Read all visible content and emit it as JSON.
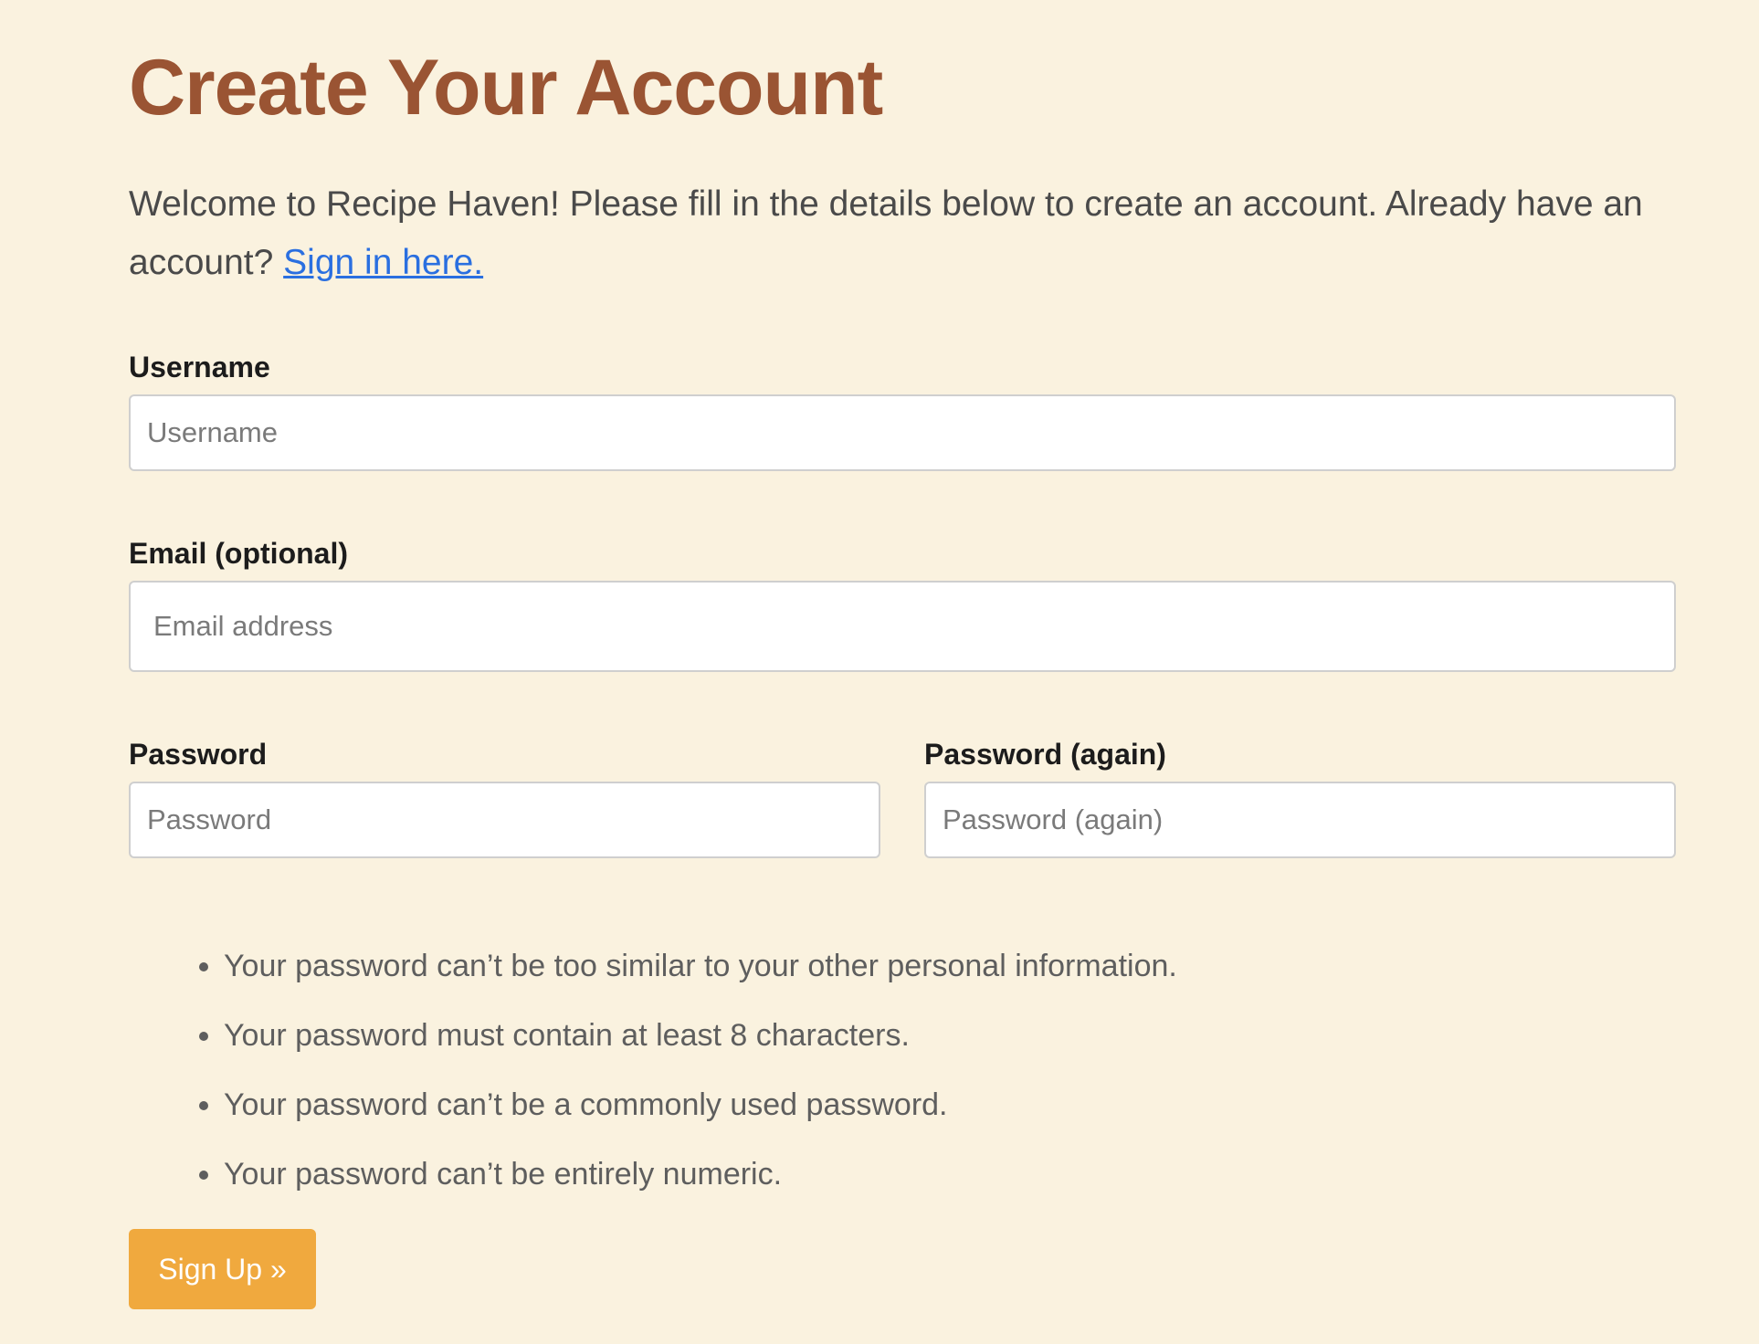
{
  "page": {
    "title": "Create Your Account",
    "intro_text": "Welcome to Recipe Haven! Please fill in the details below to create an account. Already have an account?",
    "signin_link": "Sign in here."
  },
  "form": {
    "username": {
      "label": "Username",
      "placeholder": "Username",
      "value": ""
    },
    "email": {
      "label": "Email (optional)",
      "placeholder": "Email address",
      "value": ""
    },
    "password": {
      "label": "Password",
      "placeholder": "Password",
      "value": ""
    },
    "password_again": {
      "label": "Password (again)",
      "placeholder": "Password (again)",
      "value": ""
    },
    "password_rules": [
      "Your password can’t be too similar to your other personal information.",
      "Your password must contain at least 8 characters.",
      "Your password can’t be a commonly used password.",
      "Your password can’t be entirely numeric."
    ],
    "submit_label": "Sign Up »"
  },
  "colors": {
    "background": "#faf2df",
    "title": "#9a5433",
    "link": "#2a6fe0",
    "button": "#f0a93e"
  }
}
